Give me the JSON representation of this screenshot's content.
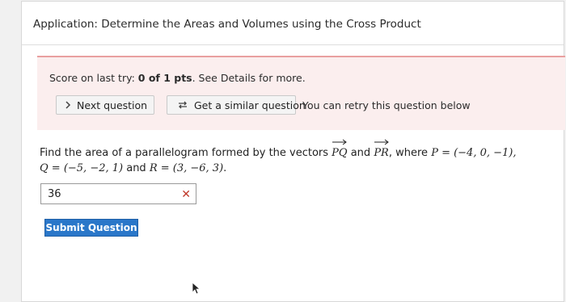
{
  "header": {
    "title": "Application: Determine the Areas and Volumes using the Cross Product"
  },
  "score": {
    "prefix": "Score on last try: ",
    "value": "0 of 1 pts",
    "suffix": ". See Details for more."
  },
  "actions": {
    "next_label": "Next question",
    "similar_label": "Get a similar question",
    "retry_text": "You can retry this question below"
  },
  "question": {
    "text_1": "Find the area of a parallelogram formed by the vectors ",
    "vec_pq": "PQ",
    "and": " and ",
    "vec_pr": "PR",
    "where": ", where ",
    "p_def": "P = (−4, 0, −1),",
    "q_def": "Q = (−5, −2, 1)",
    "r_def": "R = (3, −6, 3)",
    "end": "."
  },
  "answer": {
    "value": "36",
    "status_icon": "x-incorrect"
  },
  "submit": {
    "label": "Submit Question"
  },
  "colors": {
    "accent": "#2a77c9",
    "error": "#c0392b",
    "panel_bg": "#fbeeee",
    "panel_border": "#e9a0a0"
  }
}
